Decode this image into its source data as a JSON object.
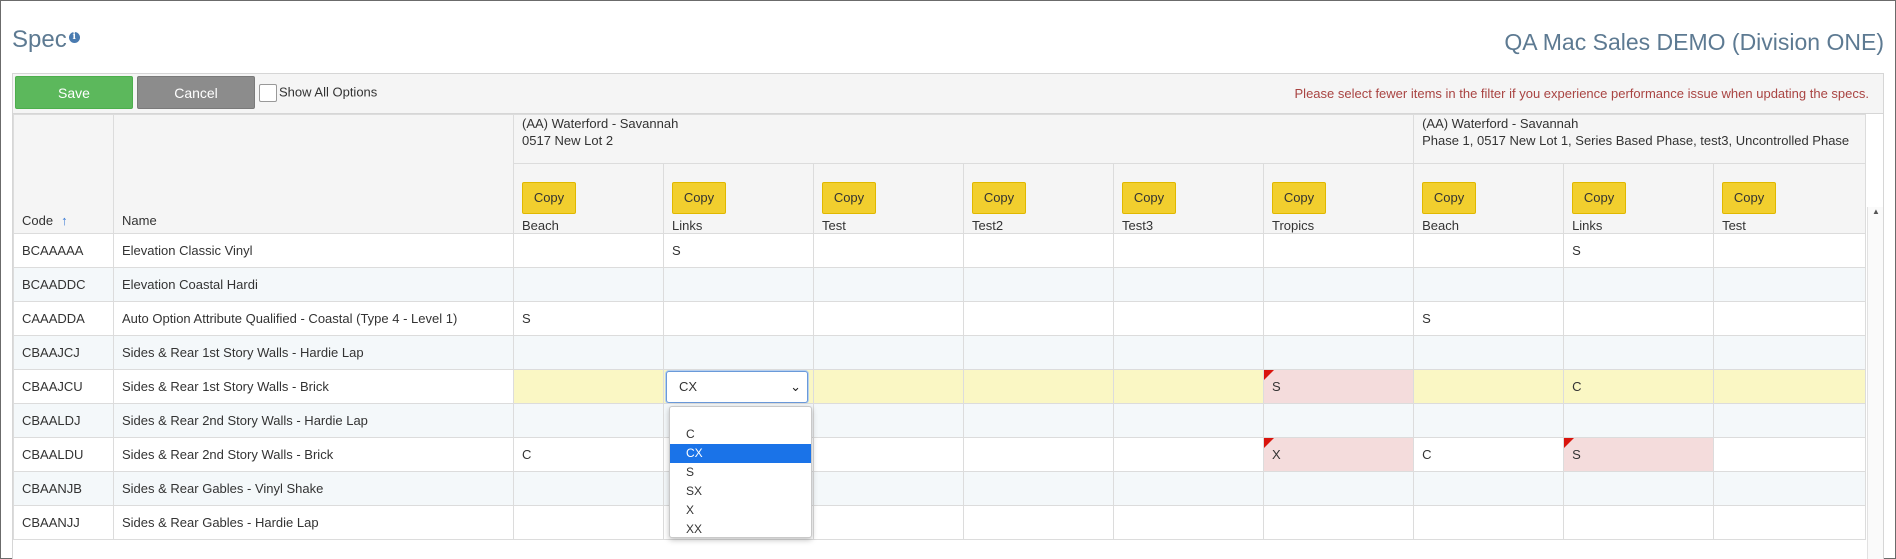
{
  "page": {
    "title": "Spec",
    "info_icon": "i",
    "company": "QA Mac Sales DEMO (Division ONE)"
  },
  "toolbar": {
    "save_label": "Save",
    "cancel_label": "Cancel",
    "show_all_label": "Show All Options",
    "warning": "Please select fewer items in the filter if you experience performance issue when updating the specs."
  },
  "table": {
    "code_header": "Code",
    "sort_icon": "↑",
    "name_header": "Name",
    "copy_label": "Copy",
    "groups": [
      {
        "line1": "(AA) Waterford - Savannah",
        "line2": "0517 New Lot 2"
      },
      {
        "line1": "(AA) Waterford - Savannah",
        "line2": "Phase 1, 0517 New Lot 1, Series Based Phase, test3, Uncontrolled Phase"
      }
    ],
    "options": [
      "Beach",
      "Links",
      "Test",
      "Test2",
      "Test3",
      "Tropics",
      "Beach",
      "Links",
      "Test"
    ],
    "rows": [
      {
        "code": "BCAAAAA",
        "name": "Elevation Classic Vinyl",
        "cells": [
          "",
          "S",
          "",
          "",
          "",
          "",
          "",
          "S",
          ""
        ]
      },
      {
        "code": "BCAADDC",
        "name": "Elevation Coastal Hardi",
        "cells": [
          "",
          "",
          "",
          "",
          "",
          "",
          "",
          "",
          ""
        ]
      },
      {
        "code": "CAAADDA",
        "name": "Auto Option Attribute Qualified - Coastal (Type 4 - Level 1)",
        "cells": [
          "S",
          "",
          "",
          "",
          "",
          "",
          "S",
          "",
          ""
        ]
      },
      {
        "code": "CBAAJCJ",
        "name": "Sides & Rear 1st Story Walls - Hardie Lap",
        "cells": [
          "",
          "",
          "",
          "",
          "",
          "",
          "",
          "",
          ""
        ]
      },
      {
        "code": "CBAAJCU",
        "name": "Sides & Rear 1st Story Walls - Brick",
        "cells": [
          "",
          "CX",
          "",
          "",
          "",
          "S",
          "",
          "C",
          ""
        ]
      },
      {
        "code": "CBAALDJ",
        "name": "Sides & Rear 2nd Story Walls - Hardie Lap",
        "cells": [
          "",
          "",
          "",
          "",
          "",
          "",
          "",
          "",
          ""
        ]
      },
      {
        "code": "CBAALDU",
        "name": "Sides & Rear 2nd Story Walls - Brick",
        "cells": [
          "C",
          "",
          "",
          "",
          "",
          "X",
          "C",
          "S",
          ""
        ]
      },
      {
        "code": "CBAANJB",
        "name": "Sides & Rear Gables - Vinyl Shake",
        "cells": [
          "",
          "",
          "",
          "",
          "",
          "",
          "",
          "",
          ""
        ]
      },
      {
        "code": "CBAANJJ",
        "name": "Sides & Rear Gables - Hardie Lap",
        "cells": [
          "",
          "",
          "",
          "",
          "",
          "",
          "",
          "",
          ""
        ]
      }
    ]
  },
  "dropdown": {
    "selected": "CX",
    "options": [
      "",
      "C",
      "CX",
      "S",
      "SX",
      "X",
      "XX"
    ]
  }
}
